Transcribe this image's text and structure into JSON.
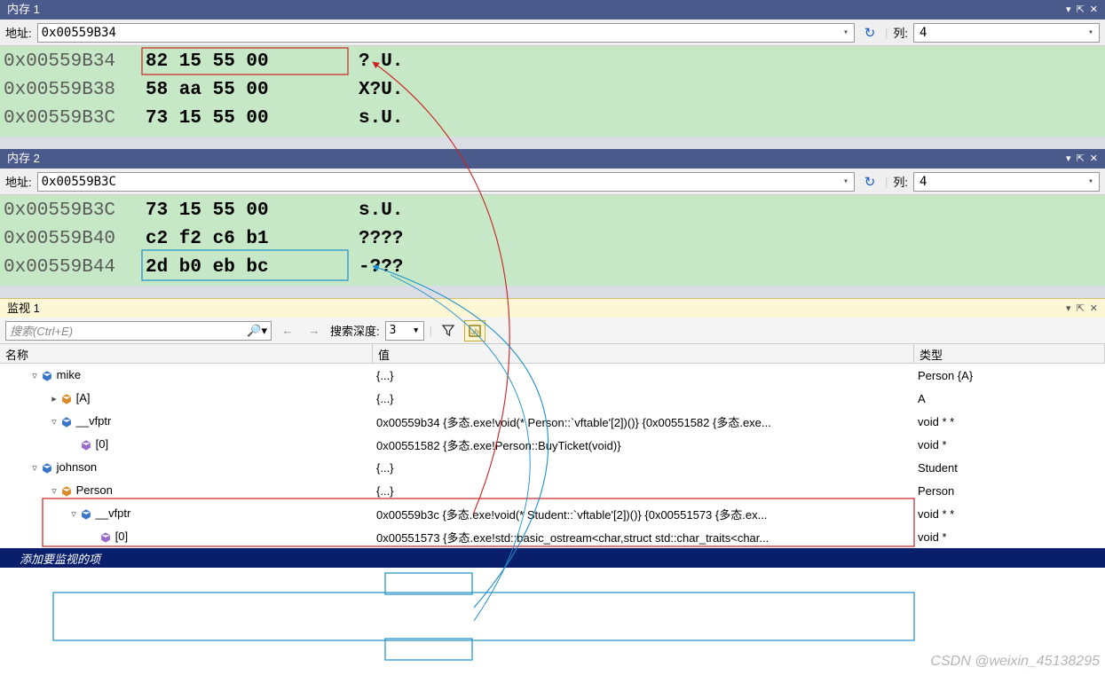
{
  "memory1": {
    "title": "内存 1",
    "addr_label": "地址:",
    "address": "0x00559B34",
    "col_label": "列:",
    "columns": "4",
    "rows": [
      {
        "addr": "0x00559B34",
        "bytes": "82 15 55 00",
        "ascii": "?.U."
      },
      {
        "addr": "0x00559B38",
        "bytes": "58 aa 55 00",
        "ascii": "X?U."
      },
      {
        "addr": "0x00559B3C",
        "bytes": "73 15 55 00",
        "ascii": "s.U."
      }
    ]
  },
  "memory2": {
    "title": "内存 2",
    "addr_label": "地址:",
    "address": "0x00559B3C",
    "col_label": "列:",
    "columns": "4",
    "rows": [
      {
        "addr": "0x00559B3C",
        "bytes": "73 15 55 00",
        "ascii": "s.U."
      },
      {
        "addr": "0x00559B40",
        "bytes": "c2 f2 c6 b1",
        "ascii": "????"
      },
      {
        "addr": "0x00559B44",
        "bytes": "2d b0 eb bc",
        "ascii": "-???"
      }
    ]
  },
  "watch": {
    "title": "监视 1",
    "search_placeholder": "搜索(Ctrl+E)",
    "depth_label": "搜索深度:",
    "depth_value": "3",
    "headers": {
      "name": "名称",
      "value": "值",
      "type": "类型"
    },
    "rows": [
      {
        "level": 1,
        "exp": "▿",
        "icon": "blue",
        "name": "mike",
        "value": "{...}",
        "type": "Person {A}"
      },
      {
        "level": 2,
        "exp": "▸",
        "icon": "orange",
        "name": "[A]",
        "value": "{...}",
        "type": "A"
      },
      {
        "level": 2,
        "exp": "▿",
        "icon": "blue",
        "name": "__vfptr",
        "value": "0x00559b34 {多态.exe!void(* Person::`vftable'[2])()} {0x00551582 {多态.exe...",
        "type": "void * *"
      },
      {
        "level": 3,
        "exp": "",
        "icon": "purple",
        "name": "[0]",
        "value": "0x00551582 {多态.exe!Person::BuyTicket(void)}",
        "type": "void *"
      },
      {
        "level": 1,
        "exp": "▿",
        "icon": "blue",
        "name": "johnson",
        "value": "{...}",
        "type": "Student"
      },
      {
        "level": 2,
        "exp": "▿",
        "icon": "orange",
        "name": "Person",
        "value": "{...}",
        "type": "Person"
      },
      {
        "level": 3,
        "exp": "▿",
        "icon": "blue",
        "name": "__vfptr",
        "value": "0x00559b3c {多态.exe!void(* Student::`vftable'[2])()} {0x00551573 {多态.ex...",
        "type": "void * *"
      },
      {
        "level": 4,
        "exp": "",
        "icon": "purple",
        "name": "[0]",
        "value": "0x00551573 {多态.exe!std::basic_ostream<char,struct std::char_traits<char...",
        "type": "void *"
      }
    ],
    "add_item_hint": "添加要监视的项"
  },
  "watermark": "CSDN @weixin_45138295"
}
